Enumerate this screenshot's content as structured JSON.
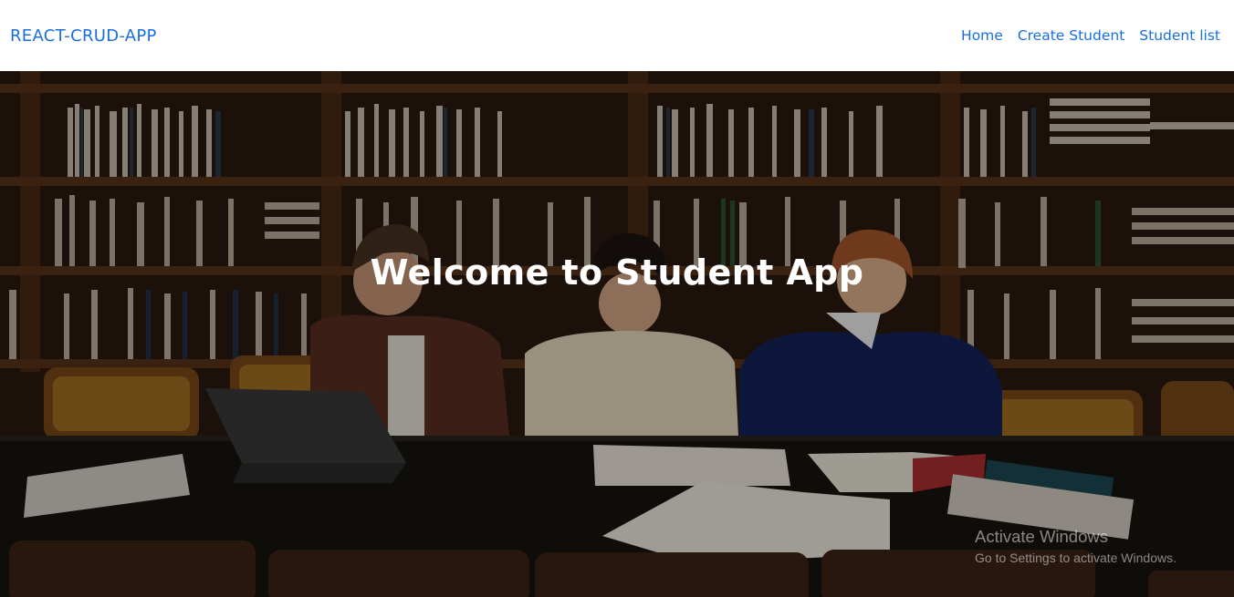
{
  "navbar": {
    "brand": "REACT-CRUD-APP",
    "links": [
      "Home",
      "Create Student",
      "Student list"
    ]
  },
  "hero": {
    "title": "Welcome to Student App",
    "image_description": "students-studying-in-library-photo"
  },
  "watermark": {
    "title": "Activate Windows",
    "subtitle": "Go to Settings to activate Windows."
  },
  "colors": {
    "accent": "#1a6fe0",
    "navbar_bg": "#ffffff",
    "hero_text": "#ffffff"
  }
}
